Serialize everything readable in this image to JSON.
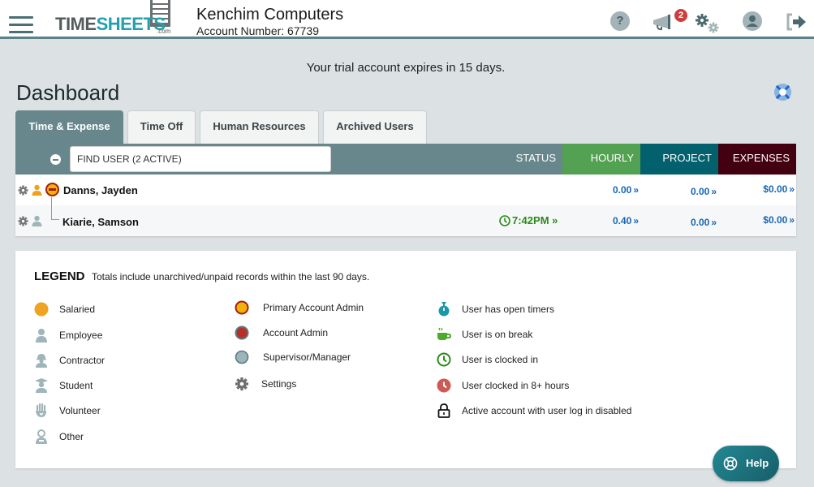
{
  "header": {
    "logo_part1": "TIME",
    "logo_part2": "SHEETS",
    "logo_dotcom": ".com",
    "company_name": "Kenchim Computers",
    "account_number": "Account Number: 67739",
    "icons": [
      "hamburger-menu-icon",
      "help-question-icon",
      "announcements-megaphone-icon",
      "settings-gears-icon",
      "user-profile-icon",
      "logout-icon"
    ],
    "notification_count": "2",
    "help_glyph": "?"
  },
  "notice": "Your trial account expires in 15 days.",
  "page_title": "Dashboard",
  "tabs": [
    {
      "label": "Time & Expense",
      "active": true
    },
    {
      "label": "Time Off",
      "active": false
    },
    {
      "label": "Human Resources",
      "active": false
    },
    {
      "label": "Archived Users",
      "active": false
    }
  ],
  "table": {
    "search_placeholder": "FIND USER (2 ACTIVE)",
    "columns": {
      "status": "STATUS",
      "hourly": "HOURLY",
      "project": "PROJECT",
      "expenses": "EXPENSES"
    },
    "column_colors": {
      "status": "#68878d",
      "hourly": "#53a152",
      "project": "#03616d",
      "expenses": "#430011"
    },
    "rows": [
      {
        "name": "Danns, Jayden",
        "role": "Primary Account Admin",
        "type": "Salaried",
        "status": "",
        "hourly": "0.00",
        "project": "0.00",
        "expenses": "$0.00"
      },
      {
        "name": "Kiarie, Samson",
        "role": "",
        "type": "Employee",
        "status": "7:42PM",
        "hourly": "0.40",
        "project": "0.00",
        "expenses": "$0.00"
      }
    ],
    "arrow": "»"
  },
  "legend": {
    "title": "LEGEND",
    "note": "Totals include unarchived/unpaid records within the last 90 days.",
    "column1": [
      {
        "icon": "salaried-dot-icon",
        "label": "Salaried"
      },
      {
        "icon": "employee-icon",
        "label": "Employee"
      },
      {
        "icon": "contractor-icon",
        "label": "Contractor"
      },
      {
        "icon": "student-icon",
        "label": "Student"
      },
      {
        "icon": "volunteer-icon",
        "label": "Volunteer"
      },
      {
        "icon": "other-icon",
        "label": "Other"
      }
    ],
    "column2": [
      {
        "icon": "primary-account-admin-icon",
        "label": "Primary Account Admin"
      },
      {
        "icon": "account-admin-icon",
        "label": "Account Admin"
      },
      {
        "icon": "supervisor-manager-icon",
        "label": "Supervisor/Manager"
      },
      {
        "icon": "settings-gear-icon",
        "label": "Settings"
      }
    ],
    "column3": [
      {
        "icon": "stopwatch-icon",
        "label": "User has open timers"
      },
      {
        "icon": "coffee-cup-icon",
        "label": "User is on break"
      },
      {
        "icon": "clock-green-icon",
        "label": "User is clocked in"
      },
      {
        "icon": "clock-red-icon",
        "label": "User clocked in 8+ hours"
      },
      {
        "icon": "lock-icon",
        "label": "Active account with user log in disabled"
      }
    ]
  },
  "help_button": {
    "label": "Help"
  }
}
